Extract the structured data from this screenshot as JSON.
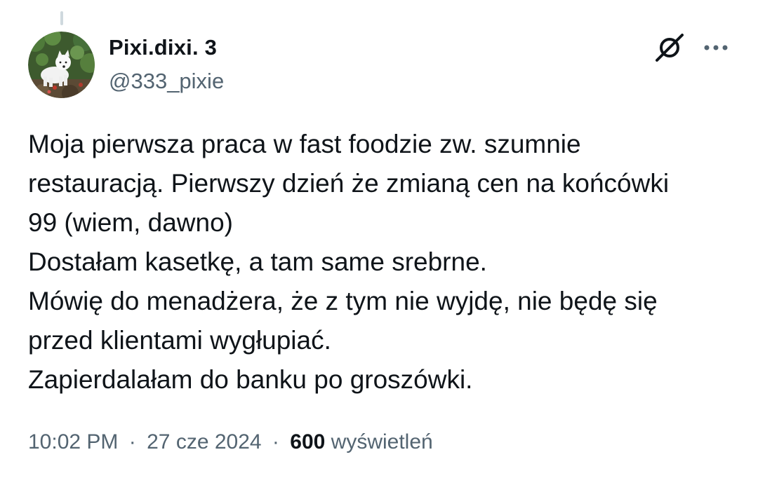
{
  "author": {
    "display_name": "Pixi.dixi. 3",
    "handle": "@333_pixie",
    "avatar_icon": "avatar-photo-white-dog"
  },
  "header_actions": {
    "grok_icon": "grok-icon",
    "more_icon": "more-horizontal-icon"
  },
  "tweet": {
    "lines": [
      "Moja pierwsza praca w fast foodzie zw. szumnie",
      "restauracją. Pierwszy dzień że zmianą cen na końcówki",
      "99 (wiem, dawno)",
      "Dostałam kasetkę, a tam same srebrne.",
      "Mówię do menadżera, że z tym nie wyjdę, nie będę się",
      "przed klientami wygłupiać.",
      "Zapierdalałam do banku po groszówki."
    ]
  },
  "meta": {
    "time": "10:02 PM",
    "separator": "·",
    "date": "27 cze 2024",
    "views_count": "600",
    "views_label": "wyświetleń"
  },
  "colors": {
    "text_primary": "#0f1419",
    "text_secondary": "#536471",
    "thread_line": "#cfd9de"
  }
}
